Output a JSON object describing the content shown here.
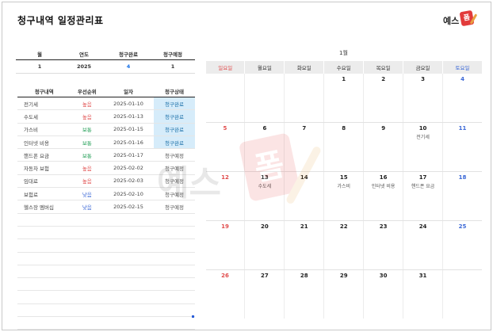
{
  "title": "청구내역 일정관리표",
  "logo": {
    "text": "예스",
    "badge": "폼"
  },
  "summary": {
    "headers": [
      "월",
      "연도",
      "청구완료",
      "청구예정"
    ],
    "values": [
      "1",
      "2025",
      "4",
      "1"
    ]
  },
  "list": {
    "headers": [
      "청구내역",
      "우선순위",
      "일자",
      "청구상태"
    ],
    "rows": [
      {
        "name": "전기세",
        "priority": "높음",
        "date": "2025-01-10",
        "status": "청구완료"
      },
      {
        "name": "수도세",
        "priority": "높음",
        "date": "2025-01-13",
        "status": "청구완료"
      },
      {
        "name": "가스비",
        "priority": "보통",
        "date": "2025-01-15",
        "status": "청구완료"
      },
      {
        "name": "인터넷 비용",
        "priority": "보통",
        "date": "2025-01-16",
        "status": "청구완료"
      },
      {
        "name": "핸드폰 요금",
        "priority": "보통",
        "date": "2025-01-17",
        "status": "청구예정"
      },
      {
        "name": "자동차 보험",
        "priority": "높음",
        "date": "2025-02-02",
        "status": "청구예정"
      },
      {
        "name": "임대료",
        "priority": "높음",
        "date": "2025-02-03",
        "status": "청구예정"
      },
      {
        "name": "보험료",
        "priority": "낮음",
        "date": "2025-02-10",
        "status": "청구예정"
      },
      {
        "name": "헬스장 멤버십",
        "priority": "낮음",
        "date": "2025-02-15",
        "status": "청구예정"
      }
    ]
  },
  "calendar": {
    "month_label": "1월",
    "weekdays": [
      "일요일",
      "월요일",
      "화요일",
      "수요일",
      "목요일",
      "금요일",
      "토요일"
    ],
    "weeks": [
      {
        "days": [
          "",
          "",
          "",
          "1",
          "2",
          "3",
          "4"
        ],
        "events": [
          "",
          "",
          "",
          "",
          "",
          "",
          ""
        ]
      },
      {
        "days": [
          "5",
          "6",
          "7",
          "8",
          "9",
          "10",
          "11"
        ],
        "events": [
          "",
          "",
          "",
          "",
          "",
          "전기세",
          ""
        ]
      },
      {
        "days": [
          "12",
          "13",
          "14",
          "15",
          "16",
          "17",
          "18"
        ],
        "events": [
          "",
          "수도세",
          "",
          "가스비",
          "인터넷 비용",
          "핸드폰 요금",
          ""
        ]
      },
      {
        "days": [
          "19",
          "20",
          "21",
          "22",
          "23",
          "24",
          "25"
        ],
        "events": [
          "",
          "",
          "",
          "",
          "",
          "",
          ""
        ]
      },
      {
        "days": [
          "26",
          "27",
          "28",
          "29",
          "30",
          "31",
          ""
        ],
        "events": [
          "",
          "",
          "",
          "",
          "",
          "",
          ""
        ]
      }
    ]
  },
  "colors": {
    "done_bg": "#d6ecfa",
    "high": "#e04b4b",
    "mid": "#27a05a",
    "low": "#3a67d6",
    "brand": "#e23b3b"
  }
}
